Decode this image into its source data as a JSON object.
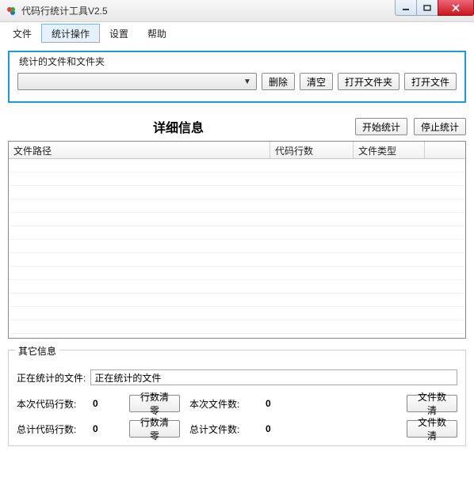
{
  "window": {
    "title": "代码行统计工具V2.5"
  },
  "menu": {
    "file": "文件",
    "stats_ops": "统计操作",
    "settings": "设置",
    "help": "帮助"
  },
  "group_files": {
    "legend": "统计的文件和文件夹",
    "delete_btn": "删除",
    "clear_btn": "清空",
    "open_folder_btn": "打开文件夹",
    "open_file_btn": "打开文件"
  },
  "detail": {
    "title": "详细信息",
    "start_btn": "开始统计",
    "stop_btn": "停止统计",
    "columns": {
      "path": "文件路径",
      "lines": "代码行数",
      "type": "文件类型"
    }
  },
  "other": {
    "legend": "其它信息",
    "current_file_label": "正在统计的文件:",
    "current_file_value": "正在统计的文件",
    "this_lines_label": "本次代码行数:",
    "this_lines_value": "0",
    "lines_reset_btn": "行数清零",
    "this_files_label": "本次文件数:",
    "this_files_value": "0",
    "files_reset_btn": "文件数清",
    "total_lines_label": "总计代码行数:",
    "total_lines_value": "0",
    "total_files_label": "总计文件数:",
    "total_files_value": "0"
  }
}
